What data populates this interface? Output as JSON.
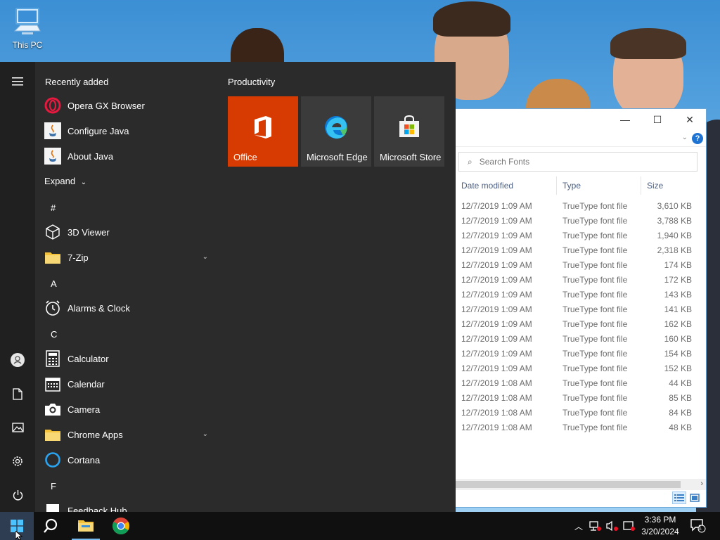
{
  "desktop": {
    "icons": [
      {
        "label": "This PC",
        "icon": "this-pc-icon"
      }
    ]
  },
  "explorer": {
    "controls": {
      "minimize": "—",
      "maximize": "☐",
      "close": "✕"
    },
    "help": "?",
    "search": {
      "placeholder": "Search Fonts"
    },
    "columns": {
      "date": "Date modified",
      "type": "Type",
      "size": "Size"
    },
    "rows": [
      {
        "date": "12/7/2019 1:09 AM",
        "type": "TrueType font file",
        "size": "3,610 KB"
      },
      {
        "date": "12/7/2019 1:09 AM",
        "type": "TrueType font file",
        "size": "3,788 KB"
      },
      {
        "date": "12/7/2019 1:09 AM",
        "type": "TrueType font file",
        "size": "1,940 KB"
      },
      {
        "date": "12/7/2019 1:09 AM",
        "type": "TrueType font file",
        "size": "2,318 KB"
      },
      {
        "date": "12/7/2019 1:09 AM",
        "type": "TrueType font file",
        "size": "174 KB"
      },
      {
        "date": "12/7/2019 1:09 AM",
        "type": "TrueType font file",
        "size": "172 KB"
      },
      {
        "date": "12/7/2019 1:09 AM",
        "type": "TrueType font file",
        "size": "143 KB"
      },
      {
        "date": "12/7/2019 1:09 AM",
        "type": "TrueType font file",
        "size": "141 KB"
      },
      {
        "date": "12/7/2019 1:09 AM",
        "type": "TrueType font file",
        "size": "162 KB"
      },
      {
        "date": "12/7/2019 1:09 AM",
        "type": "TrueType font file",
        "size": "160 KB"
      },
      {
        "date": "12/7/2019 1:09 AM",
        "type": "TrueType font file",
        "size": "154 KB"
      },
      {
        "date": "12/7/2019 1:09 AM",
        "type": "TrueType font file",
        "size": "152 KB"
      },
      {
        "date": "12/7/2019 1:08 AM",
        "type": "TrueType font file",
        "size": "44 KB"
      },
      {
        "date": "12/7/2019 1:08 AM",
        "type": "TrueType font file",
        "size": "85 KB"
      },
      {
        "date": "12/7/2019 1:08 AM",
        "type": "TrueType font file",
        "size": "84 KB"
      },
      {
        "date": "12/7/2019 1:08 AM",
        "type": "TrueType font file",
        "size": "48 KB"
      }
    ]
  },
  "start_menu": {
    "recently_added": "Recently added",
    "recent_apps": [
      {
        "name": "Opera GX Browser",
        "icon": "opera-gx-icon"
      },
      {
        "name": "Configure Java",
        "icon": "java-icon"
      },
      {
        "name": "About Java",
        "icon": "java-icon"
      }
    ],
    "expand": "Expand",
    "letters": {
      "hash": "#",
      "a": "A",
      "c": "C",
      "f": "F"
    },
    "apps": {
      "viewer3d": "3D Viewer",
      "zip": "7-Zip",
      "alarms": "Alarms & Clock",
      "calculator": "Calculator",
      "calendar": "Calendar",
      "camera": "Camera",
      "chrome_apps": "Chrome Apps",
      "cortana": "Cortana",
      "feedback": "Feedback Hub"
    },
    "group_title": "Productivity",
    "tiles": [
      {
        "name": "Office",
        "color": "#d83b01"
      },
      {
        "name": "Microsoft Edge",
        "color": "#3b3b3b"
      },
      {
        "name": "Microsoft Store",
        "color": "#3b3b3b"
      }
    ]
  },
  "taskbar": {
    "time": "3:36 PM",
    "date": "3/20/2024",
    "notification_count": "1"
  },
  "colors": {
    "accent": "#d83b01",
    "start_bg": "#2b2b2b",
    "taskbar_bg": "#101010"
  }
}
